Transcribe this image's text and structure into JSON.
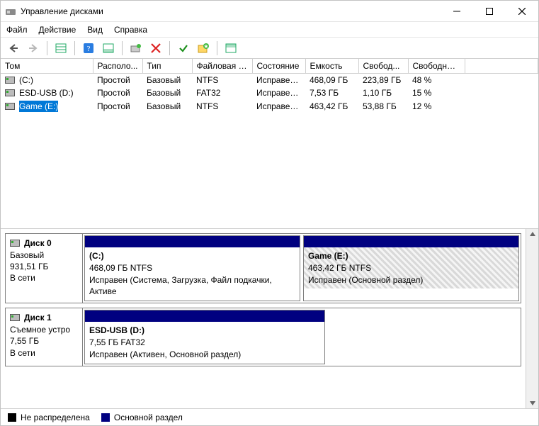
{
  "window": {
    "title": "Управление дисками"
  },
  "menu": {
    "file": "Файл",
    "action": "Действие",
    "view": "Вид",
    "help": "Справка"
  },
  "columns": {
    "tom": "Том",
    "raspolo": "Располо...",
    "tip": "Тип",
    "fs": "Файловая с...",
    "state": "Состояние",
    "capacity": "Емкость",
    "free": "Свобод...",
    "freepct": "Свободно %"
  },
  "volumes": [
    {
      "name": "(C:)",
      "layout": "Простой",
      "type": "Базовый",
      "fs": "NTFS",
      "state": "Исправен...",
      "capacity": "468,09 ГБ",
      "free": "223,89 ГБ",
      "freepct": "48 %",
      "selected": false
    },
    {
      "name": "ESD-USB (D:)",
      "layout": "Простой",
      "type": "Базовый",
      "fs": "FAT32",
      "state": "Исправен...",
      "capacity": "7,53 ГБ",
      "free": "1,10 ГБ",
      "freepct": "15 %",
      "selected": false
    },
    {
      "name": "Game (E:)",
      "layout": "Простой",
      "type": "Базовый",
      "fs": "NTFS",
      "state": "Исправен...",
      "capacity": "463,42 ГБ",
      "free": "53,88 ГБ",
      "freepct": "12 %",
      "selected": true
    }
  ],
  "disks": [
    {
      "name": "Диск 0",
      "meta1": "Базовый",
      "meta2": "931,51 ГБ",
      "meta3": "В сети",
      "parts": [
        {
          "title": "(C:)",
          "line1": "468,09 ГБ NTFS",
          "line2": "Исправен (Система, Загрузка, Файл подкачки, Активе",
          "hatch": false
        },
        {
          "title": "Game  (E:)",
          "line1": "463,42 ГБ NTFS",
          "line2": "Исправен (Основной раздел)",
          "hatch": true
        }
      ]
    },
    {
      "name": "Диск 1",
      "meta1": "Съемное устро",
      "meta2": "7,55 ГБ",
      "meta3": "В сети",
      "parts": [
        {
          "title": "ESD-USB  (D:)",
          "line1": "7,55 ГБ FAT32",
          "line2": "Исправен (Активен, Основной раздел)",
          "hatch": false
        }
      ]
    }
  ],
  "legend": {
    "unallocated": "Не распределена",
    "primary": "Основной раздел"
  }
}
